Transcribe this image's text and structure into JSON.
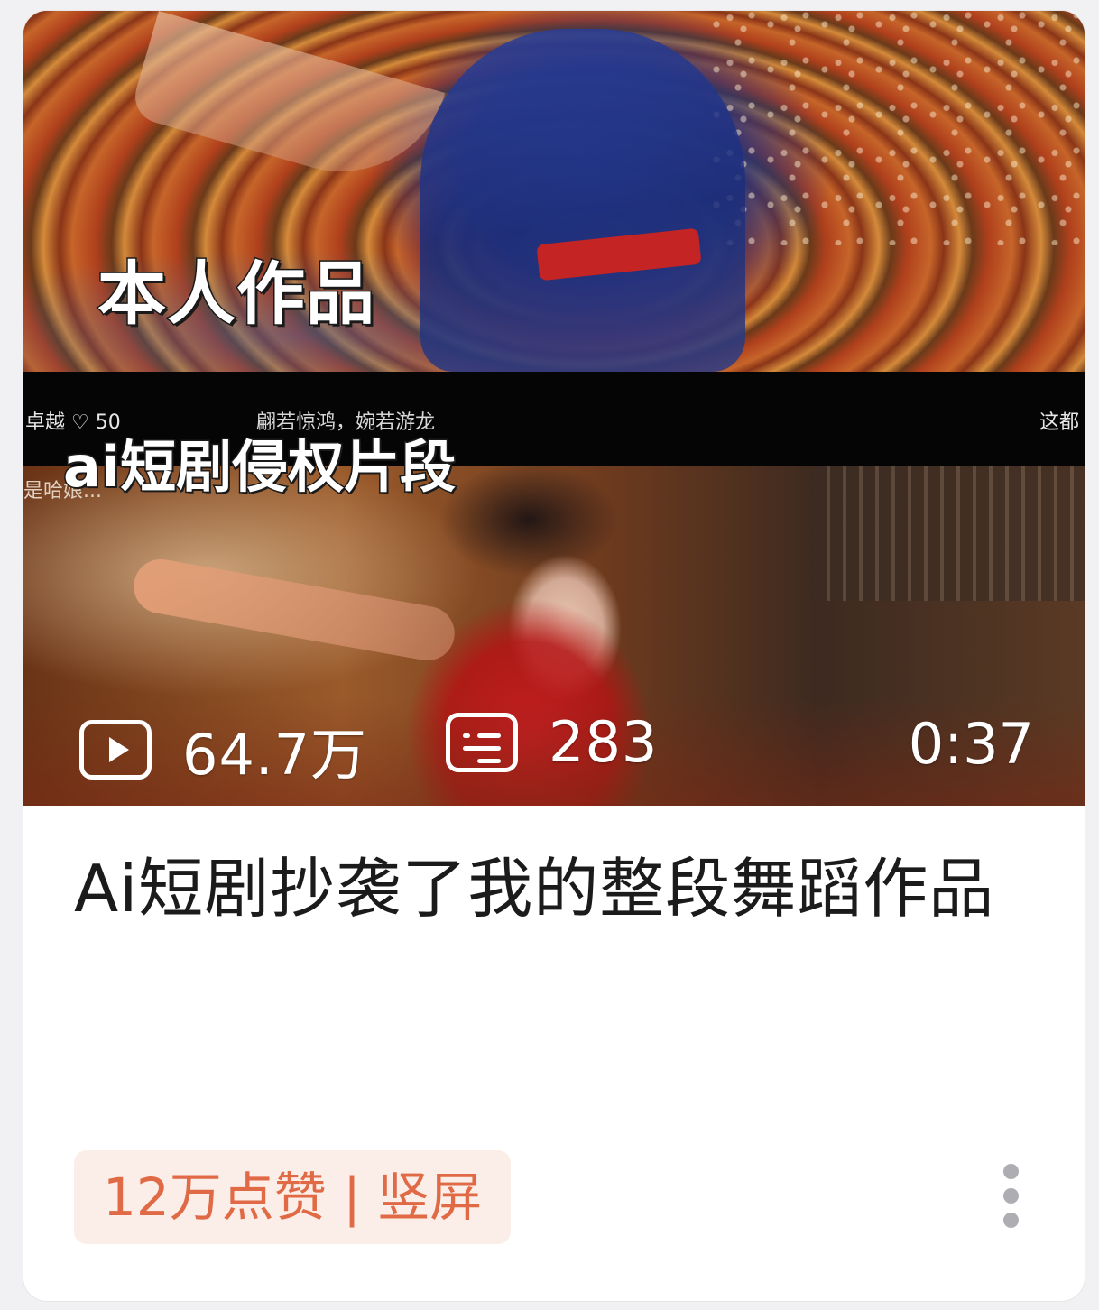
{
  "video": {
    "thumbnail": {
      "caption_top": "本人作品",
      "caption_mid": "ai短剧侵权片段",
      "overlay_author": "卓越 ♡ 50",
      "overlay_verse": "翩若惊鸿，婉若游龙",
      "overlay_right": "这都",
      "overlay_side": "是哈娘..."
    },
    "stats": {
      "play_icon": "play-icon",
      "play_count": "64.7万",
      "danmaku_icon": "danmaku-icon",
      "danmaku_count": "283",
      "duration": "0:37"
    },
    "title": "Ai短剧抄袭了我的整段舞蹈作品",
    "tag": "12万点赞 | 竖屏",
    "more_icon": "more-vertical-icon"
  },
  "colors": {
    "tag_text": "#e06a45",
    "tag_bg": "#fbeee8",
    "title_text": "#1b1b1b"
  }
}
